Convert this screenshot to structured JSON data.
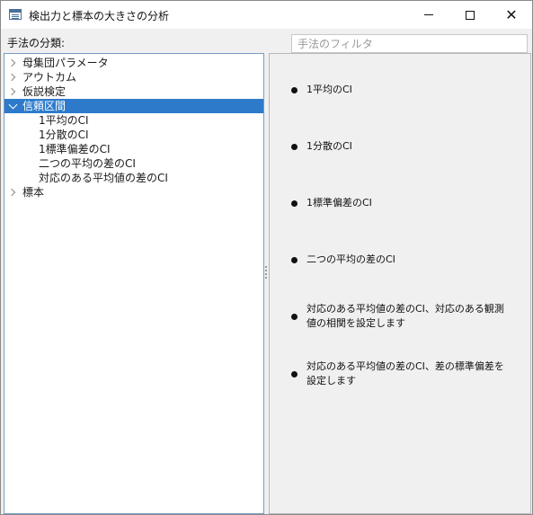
{
  "window": {
    "title": "検出力と標本の大きさの分析",
    "minimize_label": "",
    "maximize_label": "",
    "close_label": "✕"
  },
  "toolbar": {
    "category_label": "手法の分類:",
    "filter_placeholder": "手法のフィルタ",
    "filter_value": ""
  },
  "tree": {
    "items": [
      {
        "label": "母集団パラメータ",
        "expanded": false
      },
      {
        "label": "アウトカム",
        "expanded": false
      },
      {
        "label": "仮説検定",
        "expanded": false
      },
      {
        "label": "信頼区間",
        "expanded": true,
        "selected": true,
        "children": [
          "1平均のCI",
          "1分散のCI",
          "1標準偏差のCI",
          "二つの平均の差のCI",
          "対応のある平均値の差のCI"
        ]
      },
      {
        "label": "標本",
        "expanded": false
      }
    ]
  },
  "details": {
    "items": [
      "1平均のCI",
      "1分散のCI",
      "1標準偏差のCI",
      "二つの平均の差のCI",
      "対応のある平均値の差のCI、対応のある観測値の相関を設定します",
      "対応のある平均値の差のCI、差の標準偏差を設定します"
    ]
  },
  "colors": {
    "selection": "#2d7acb",
    "tree_border": "#7a9cc4",
    "pane_background": "#f0f0f0"
  }
}
